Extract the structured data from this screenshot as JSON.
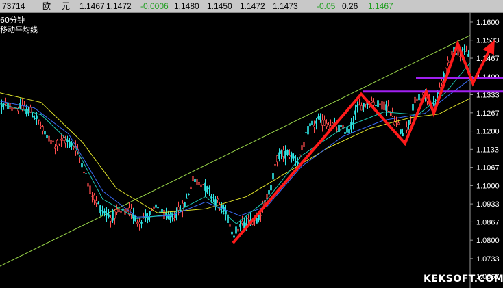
{
  "topbar": {
    "items": [
      {
        "text": "73714",
        "color": "#000000"
      },
      {
        "text": "欧",
        "color": "#000000"
      },
      {
        "text": "元",
        "color": "#000000"
      },
      {
        "text": "1.1467",
        "color": "#000000"
      },
      {
        "text": "1.1472",
        "color": "#000000"
      },
      {
        "text": "-0.0006",
        "color": "#1e9e1e"
      },
      {
        "text": "1.1480",
        "color": "#000000"
      },
      {
        "text": "1.1450",
        "color": "#000000"
      },
      {
        "text": "1.1472",
        "color": "#000000"
      },
      {
        "text": "1.1473",
        "color": "#000000"
      },
      {
        "text": "-0.05",
        "color": "#1e9e1e"
      },
      {
        "text": "0.26",
        "color": "#000000"
      },
      {
        "text": "1.1467",
        "color": "#1e9e1e"
      }
    ]
  },
  "period_label": "60分钟",
  "ma_label": "移动平均线",
  "watermark": "KEKSOFT.COM",
  "chart_data": {
    "type": "candlestick",
    "ylim": [
      1.0625,
      1.1635
    ],
    "y_ticks": [
      "1.1600",
      "1.1533",
      "1.1467",
      "1.1400",
      "1.1333",
      "1.1267",
      "1.1200",
      "1.1133",
      "1.1067",
      "1.1000",
      "1.0933",
      "1.0867",
      "1.0800",
      "1.0733",
      "1.0667"
    ],
    "price_path": [
      [
        0,
        1.1295
      ],
      [
        15,
        1.129
      ],
      [
        30,
        1.1285
      ],
      [
        45,
        1.127
      ],
      [
        55,
        1.124
      ],
      [
        65,
        1.1185
      ],
      [
        80,
        1.115
      ],
      [
        95,
        1.1165
      ],
      [
        110,
        1.114
      ],
      [
        120,
        1.108
      ],
      [
        130,
        1.099
      ],
      [
        145,
        1.092
      ],
      [
        160,
        1.0885
      ],
      [
        175,
        1.09
      ],
      [
        190,
        1.0905
      ],
      [
        200,
        1.087
      ],
      [
        215,
        1.089
      ],
      [
        230,
        1.092
      ],
      [
        245,
        1.0875
      ],
      [
        260,
        1.0905
      ],
      [
        270,
        1.0935
      ],
      [
        280,
        1.102
      ],
      [
        295,
        1.101
      ],
      [
        310,
        1.096
      ],
      [
        320,
        1.093
      ],
      [
        330,
        1.089
      ],
      [
        340,
        1.0825
      ],
      [
        350,
        1.085
      ],
      [
        362,
        1.087
      ],
      [
        375,
        1.088
      ],
      [
        385,
        1.093
      ],
      [
        395,
        1.1
      ],
      [
        405,
        1.111
      ],
      [
        420,
        1.112
      ],
      [
        435,
        1.109
      ],
      [
        450,
        1.121
      ],
      [
        465,
        1.124
      ],
      [
        480,
        1.122
      ],
      [
        495,
        1.121
      ],
      [
        510,
        1.12
      ],
      [
        520,
        1.128
      ],
      [
        535,
        1.131
      ],
      [
        550,
        1.13
      ],
      [
        565,
        1.129
      ],
      [
        575,
        1.124
      ],
      [
        590,
        1.118
      ],
      [
        605,
        1.131
      ],
      [
        620,
        1.133
      ],
      [
        632,
        1.129
      ],
      [
        645,
        1.138
      ],
      [
        660,
        1.15
      ],
      [
        670,
        1.149
      ],
      [
        685,
        1.148
      ]
    ],
    "ma_lines": [
      {
        "color": "#dfe32a",
        "path": [
          [
            0,
            1.134
          ],
          [
            60,
            1.1305
          ],
          [
            120,
            1.116
          ],
          [
            170,
            1.099
          ],
          [
            230,
            1.09
          ],
          [
            300,
            1.0915
          ],
          [
            360,
            1.096
          ],
          [
            420,
            1.105
          ],
          [
            480,
            1.114
          ],
          [
            540,
            1.121
          ],
          [
            600,
            1.125
          ],
          [
            640,
            1.1262
          ],
          [
            686,
            1.132
          ]
        ]
      },
      {
        "color": "#3a6cf5",
        "path": [
          [
            0,
            1.131
          ],
          [
            50,
            1.1285
          ],
          [
            100,
            1.119
          ],
          [
            150,
            1.098
          ],
          [
            200,
            1.0885
          ],
          [
            250,
            1.089
          ],
          [
            300,
            1.094
          ],
          [
            350,
            1.089
          ],
          [
            390,
            1.0925
          ],
          [
            440,
            1.107
          ],
          [
            500,
            1.118
          ],
          [
            560,
            1.124
          ],
          [
            620,
            1.1265
          ],
          [
            686,
            1.139
          ]
        ]
      },
      {
        "color": "#1ec8b4",
        "path": [
          [
            0,
            1.13
          ],
          [
            60,
            1.126
          ],
          [
            110,
            1.114
          ],
          [
            150,
            1.095
          ],
          [
            200,
            1.088
          ],
          [
            250,
            1.0895
          ],
          [
            300,
            1.096
          ],
          [
            345,
            1.086
          ],
          [
            390,
            1.095
          ],
          [
            440,
            1.111
          ],
          [
            500,
            1.121
          ],
          [
            560,
            1.127
          ],
          [
            610,
            1.126
          ],
          [
            650,
            1.134
          ],
          [
            686,
            1.145
          ]
        ]
      }
    ],
    "trendline": {
      "color": "#9bd94a",
      "points": [
        [
          0,
          1.0705
        ],
        [
          686,
          1.1551
        ]
      ]
    },
    "resistance_lines": [
      {
        "color": "#a020f0",
        "start": 530,
        "end": 734,
        "price": 1.1345
      },
      {
        "color": "#a020f0",
        "start": 607,
        "end": 734,
        "price": 1.1395
      }
    ],
    "annotation_arrow": {
      "color": "#ff1a1a",
      "points": [
        [
          340,
          1.079
        ],
        [
          527,
          1.1335
        ],
        [
          591,
          1.1155
        ],
        [
          622,
          1.1345
        ],
        [
          633,
          1.1265
        ],
        [
          668,
          1.152
        ],
        [
          690,
          1.1375
        ],
        [
          720,
          1.1525
        ]
      ]
    }
  }
}
